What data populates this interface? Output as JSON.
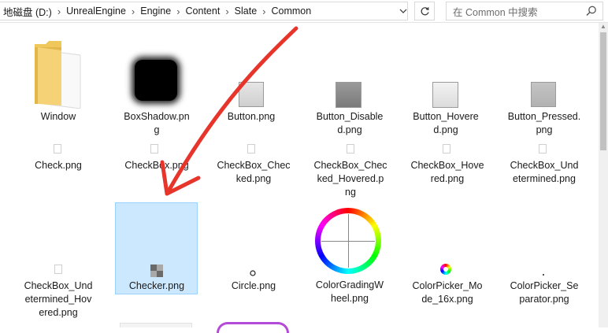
{
  "address": {
    "path": [
      "地磁盘 (D:)",
      "UnrealEngine",
      "Engine",
      "Content",
      "Slate",
      "Common"
    ]
  },
  "search": {
    "placeholder": "在 Common 中搜索"
  },
  "files": {
    "window": "Window",
    "boxshadow": "BoxShadow.png",
    "button": "Button.png",
    "button_disabled": "Button_Disabled.png",
    "button_hovered": "Button_Hovered.png",
    "button_pressed": "Button_Pressed.png",
    "check": "Check.png",
    "checkbox": "CheckBox.png",
    "checkbox_checked": "CheckBox_Checked.png",
    "checkbox_checked_hovered": "CheckBox_Checked_Hovered.png",
    "checkbox_hovered": "CheckBox_Hovered.png",
    "checkbox_undetermined": "CheckBox_Undetermined.png",
    "checkbox_undetermined_hovered": "CheckBox_Undetermined_Hovered.png",
    "checker": "Checker.png",
    "circle": "Circle.png",
    "colorgradingwheel": "ColorGradingWheel.png",
    "colorpicker_mode": "ColorPicker_Mode_16x.png",
    "colorpicker_separator": "ColorPicker_Separator.png"
  },
  "labels": {
    "window": [
      "Window"
    ],
    "boxshadow": [
      "BoxShadow.pn",
      "g"
    ],
    "button": [
      "Button.png"
    ],
    "button_disabled": [
      "Button_Disable",
      "d.png"
    ],
    "button_hovered": [
      "Button_Hovere",
      "d.png"
    ],
    "button_pressed": [
      "Button_Pressed.",
      "png"
    ],
    "check": [
      "Check.png"
    ],
    "checkbox": [
      "CheckBox.png"
    ],
    "checkbox_checked": [
      "CheckBox_Chec",
      "ked.png"
    ],
    "checkbox_checked_hovered": [
      "CheckBox_Chec",
      "ked_Hovered.p",
      "ng"
    ],
    "checkbox_hovered": [
      "CheckBox_Hove",
      "red.png"
    ],
    "checkbox_undetermined": [
      "CheckBox_Und",
      "etermined.png"
    ],
    "checkbox_undetermined_hovered": [
      "CheckBox_Und",
      "etermined_Hov",
      "ered.png"
    ],
    "checker": [
      "Checker.png"
    ],
    "circle": [
      "Circle.png"
    ],
    "colorgradingwheel": [
      "ColorGradingW",
      "heel.png"
    ],
    "colorpicker_mode": [
      "ColorPicker_Mo",
      "de_16x.png"
    ],
    "colorpicker_separator": [
      "ColorPicker_Se",
      "parator.png"
    ]
  },
  "selected_item": "Checker.png",
  "colors": {
    "selection": "#cce8ff",
    "selection_border": "#99d1ff",
    "annotation_arrow": "#e8352b",
    "folder": "#f3cd63"
  },
  "icons": [
    "folder-icon",
    "image-thumbnail",
    "refresh-icon",
    "search-icon",
    "chevron-down-icon",
    "annotation-arrow"
  ]
}
